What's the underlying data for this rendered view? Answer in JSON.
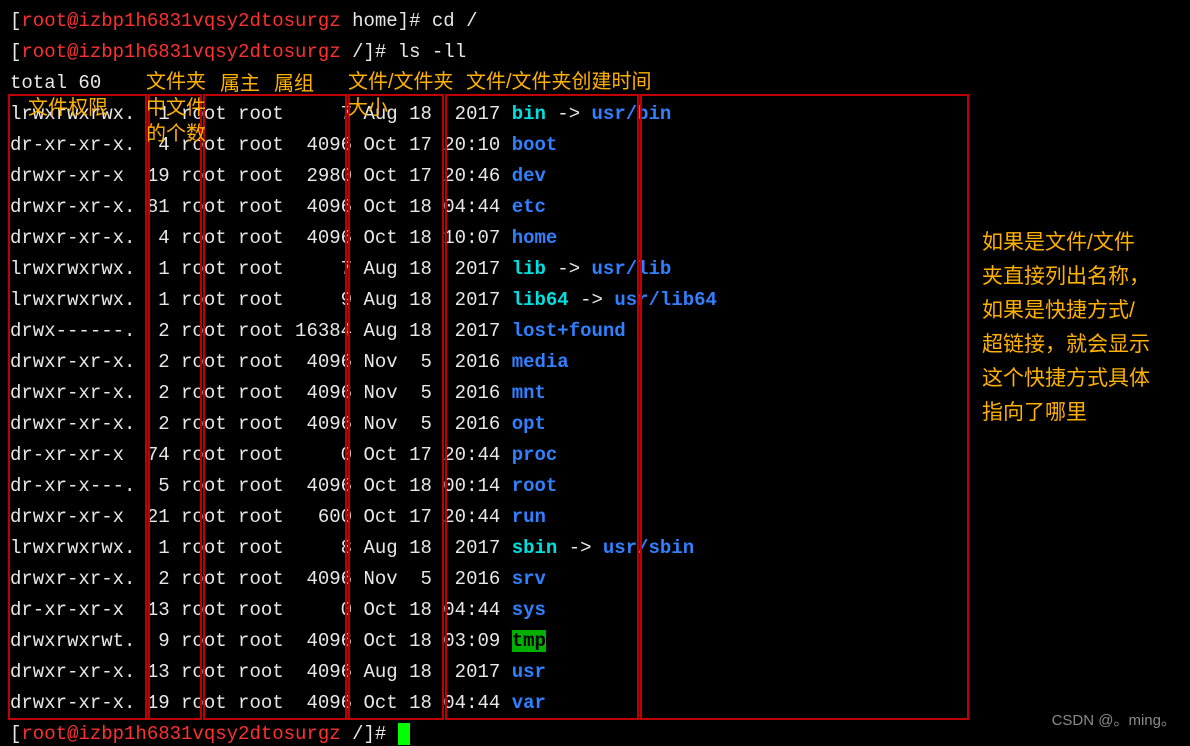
{
  "prompt": {
    "user": "root",
    "host": "izbp1h6831vqsy2dtosurgz",
    "path_home": "home",
    "path_root": "/",
    "cmd1": "cd /",
    "cmd2": "ls -ll",
    "total": "total 60"
  },
  "labels": {
    "perm": "文件权限",
    "folder": "文件夹",
    "count1": "中文件",
    "count2": "的个数",
    "owner": "属主",
    "group": "属组",
    "ff": "文件/文件夹",
    "size": "大小",
    "date": "文件/文件夹创建时间",
    "note": "如果是文件/文件\n夹直接列出名称，\n如果是快捷方式/\n超链接，就会显示\n这个快捷方式具体\n指向了哪里"
  },
  "rows": [
    {
      "perm": "lrwxrwxrwx.",
      "lnk": " 1",
      "own": "root",
      "grp": "root",
      "size": "    7",
      "mon": "Aug",
      "day": "18",
      "time": " 2017",
      "name": "bin",
      "t": "link",
      "tgt": "usr/bin"
    },
    {
      "perm": "dr-xr-xr-x.",
      "lnk": " 4",
      "own": "root",
      "grp": "root",
      "size": " 4096",
      "mon": "Oct",
      "day": "17",
      "time": "20:10",
      "name": "boot",
      "t": "dir"
    },
    {
      "perm": "drwxr-xr-x ",
      "lnk": "19",
      "own": "root",
      "grp": "root",
      "size": " 2980",
      "mon": "Oct",
      "day": "17",
      "time": "20:46",
      "name": "dev",
      "t": "dir"
    },
    {
      "perm": "drwxr-xr-x.",
      "lnk": "81",
      "own": "root",
      "grp": "root",
      "size": " 4096",
      "mon": "Oct",
      "day": "18",
      "time": "04:44",
      "name": "etc",
      "t": "dir"
    },
    {
      "perm": "drwxr-xr-x.",
      "lnk": " 4",
      "own": "root",
      "grp": "root",
      "size": " 4096",
      "mon": "Oct",
      "day": "18",
      "time": "10:07",
      "name": "home",
      "t": "dir"
    },
    {
      "perm": "lrwxrwxrwx.",
      "lnk": " 1",
      "own": "root",
      "grp": "root",
      "size": "    7",
      "mon": "Aug",
      "day": "18",
      "time": " 2017",
      "name": "lib",
      "t": "link",
      "tgt": "usr/lib"
    },
    {
      "perm": "lrwxrwxrwx.",
      "lnk": " 1",
      "own": "root",
      "grp": "root",
      "size": "    9",
      "mon": "Aug",
      "day": "18",
      "time": " 2017",
      "name": "lib64",
      "t": "link",
      "tgt": "usr/lib64"
    },
    {
      "perm": "drwx------.",
      "lnk": " 2",
      "own": "root",
      "grp": "root",
      "size": "16384",
      "mon": "Aug",
      "day": "18",
      "time": " 2017",
      "name": "lost+found",
      "t": "dir"
    },
    {
      "perm": "drwxr-xr-x.",
      "lnk": " 2",
      "own": "root",
      "grp": "root",
      "size": " 4096",
      "mon": "Nov",
      "day": " 5",
      "time": " 2016",
      "name": "media",
      "t": "dir"
    },
    {
      "perm": "drwxr-xr-x.",
      "lnk": " 2",
      "own": "root",
      "grp": "root",
      "size": " 4096",
      "mon": "Nov",
      "day": " 5",
      "time": " 2016",
      "name": "mnt",
      "t": "dir"
    },
    {
      "perm": "drwxr-xr-x.",
      "lnk": " 2",
      "own": "root",
      "grp": "root",
      "size": " 4096",
      "mon": "Nov",
      "day": " 5",
      "time": " 2016",
      "name": "opt",
      "t": "dir"
    },
    {
      "perm": "dr-xr-xr-x ",
      "lnk": "74",
      "own": "root",
      "grp": "root",
      "size": "    0",
      "mon": "Oct",
      "day": "17",
      "time": "20:44",
      "name": "proc",
      "t": "dir"
    },
    {
      "perm": "dr-xr-x---.",
      "lnk": " 5",
      "own": "root",
      "grp": "root",
      "size": " 4096",
      "mon": "Oct",
      "day": "18",
      "time": "00:14",
      "name": "root",
      "t": "dir"
    },
    {
      "perm": "drwxr-xr-x ",
      "lnk": "21",
      "own": "root",
      "grp": "root",
      "size": "  600",
      "mon": "Oct",
      "day": "17",
      "time": "20:44",
      "name": "run",
      "t": "dir"
    },
    {
      "perm": "lrwxrwxrwx.",
      "lnk": " 1",
      "own": "root",
      "grp": "root",
      "size": "    8",
      "mon": "Aug",
      "day": "18",
      "time": " 2017",
      "name": "sbin",
      "t": "link",
      "tgt": "usr/sbin"
    },
    {
      "perm": "drwxr-xr-x.",
      "lnk": " 2",
      "own": "root",
      "grp": "root",
      "size": " 4096",
      "mon": "Nov",
      "day": " 5",
      "time": " 2016",
      "name": "srv",
      "t": "dir"
    },
    {
      "perm": "dr-xr-xr-x ",
      "lnk": "13",
      "own": "root",
      "grp": "root",
      "size": "    0",
      "mon": "Oct",
      "day": "18",
      "time": "04:44",
      "name": "sys",
      "t": "dir"
    },
    {
      "perm": "drwxrwxrwt.",
      "lnk": " 9",
      "own": "root",
      "grp": "root",
      "size": " 4096",
      "mon": "Oct",
      "day": "18",
      "time": "03:09",
      "name": "tmp",
      "t": "tmp"
    },
    {
      "perm": "drwxr-xr-x.",
      "lnk": "13",
      "own": "root",
      "grp": "root",
      "size": " 4096",
      "mon": "Aug",
      "day": "18",
      "time": " 2017",
      "name": "usr",
      "t": "dir"
    },
    {
      "perm": "drwxr-xr-x.",
      "lnk": "19",
      "own": "root",
      "grp": "root",
      "size": " 4096",
      "mon": "Oct",
      "day": "18",
      "time": "04:44",
      "name": "var",
      "t": "dir"
    }
  ],
  "watermark": "CSDN @。ming。"
}
